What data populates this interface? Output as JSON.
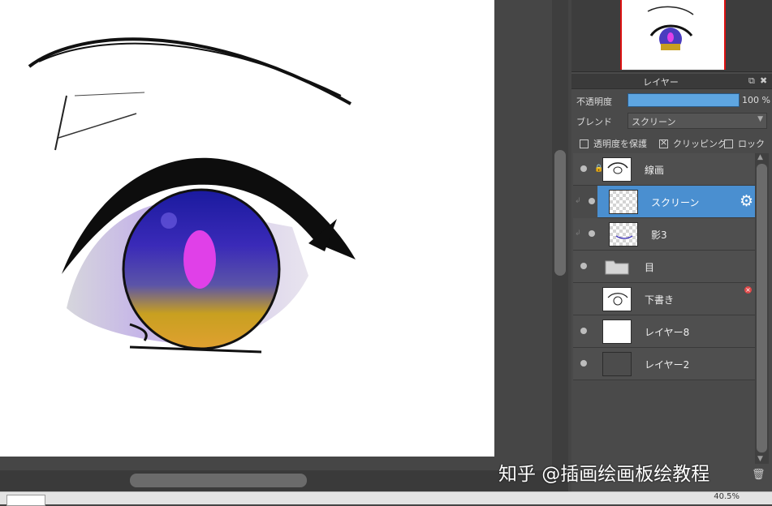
{
  "layer_panel": {
    "title": "レイヤー",
    "opacity_label": "不透明度",
    "opacity_value": "100 %",
    "opacity_fraction": 1.0,
    "blend_label": "ブレンド",
    "blend_value": "スクリーン",
    "protect_alpha_label": "透明度を保護",
    "protect_alpha_checked": false,
    "clipping_label": "クリッピング",
    "clipping_checked": true,
    "lock_label": "ロック",
    "lock_checked": false,
    "layers": [
      {
        "name": "線画",
        "locked": true,
        "selected": false
      },
      {
        "name": "スクリーン",
        "clipped": true,
        "selected": true
      },
      {
        "name": "影3",
        "clipped": true,
        "selected": false
      },
      {
        "name": "目",
        "type": "folder",
        "selected": false
      },
      {
        "name": "下書き",
        "visible": false,
        "selected": false
      },
      {
        "name": "レイヤー8",
        "selected": false
      },
      {
        "name": "レイヤー2",
        "selected": false
      }
    ]
  },
  "status": {
    "zoom": "40.5%"
  },
  "watermark": "知乎 @插画绘画板绘教程",
  "colors": {
    "selected_layer": "#4a8fd0",
    "opacity_bar": "#5ea6e2",
    "iris_highlight": "#e040e8",
    "nav_frame": "#dd1111"
  }
}
